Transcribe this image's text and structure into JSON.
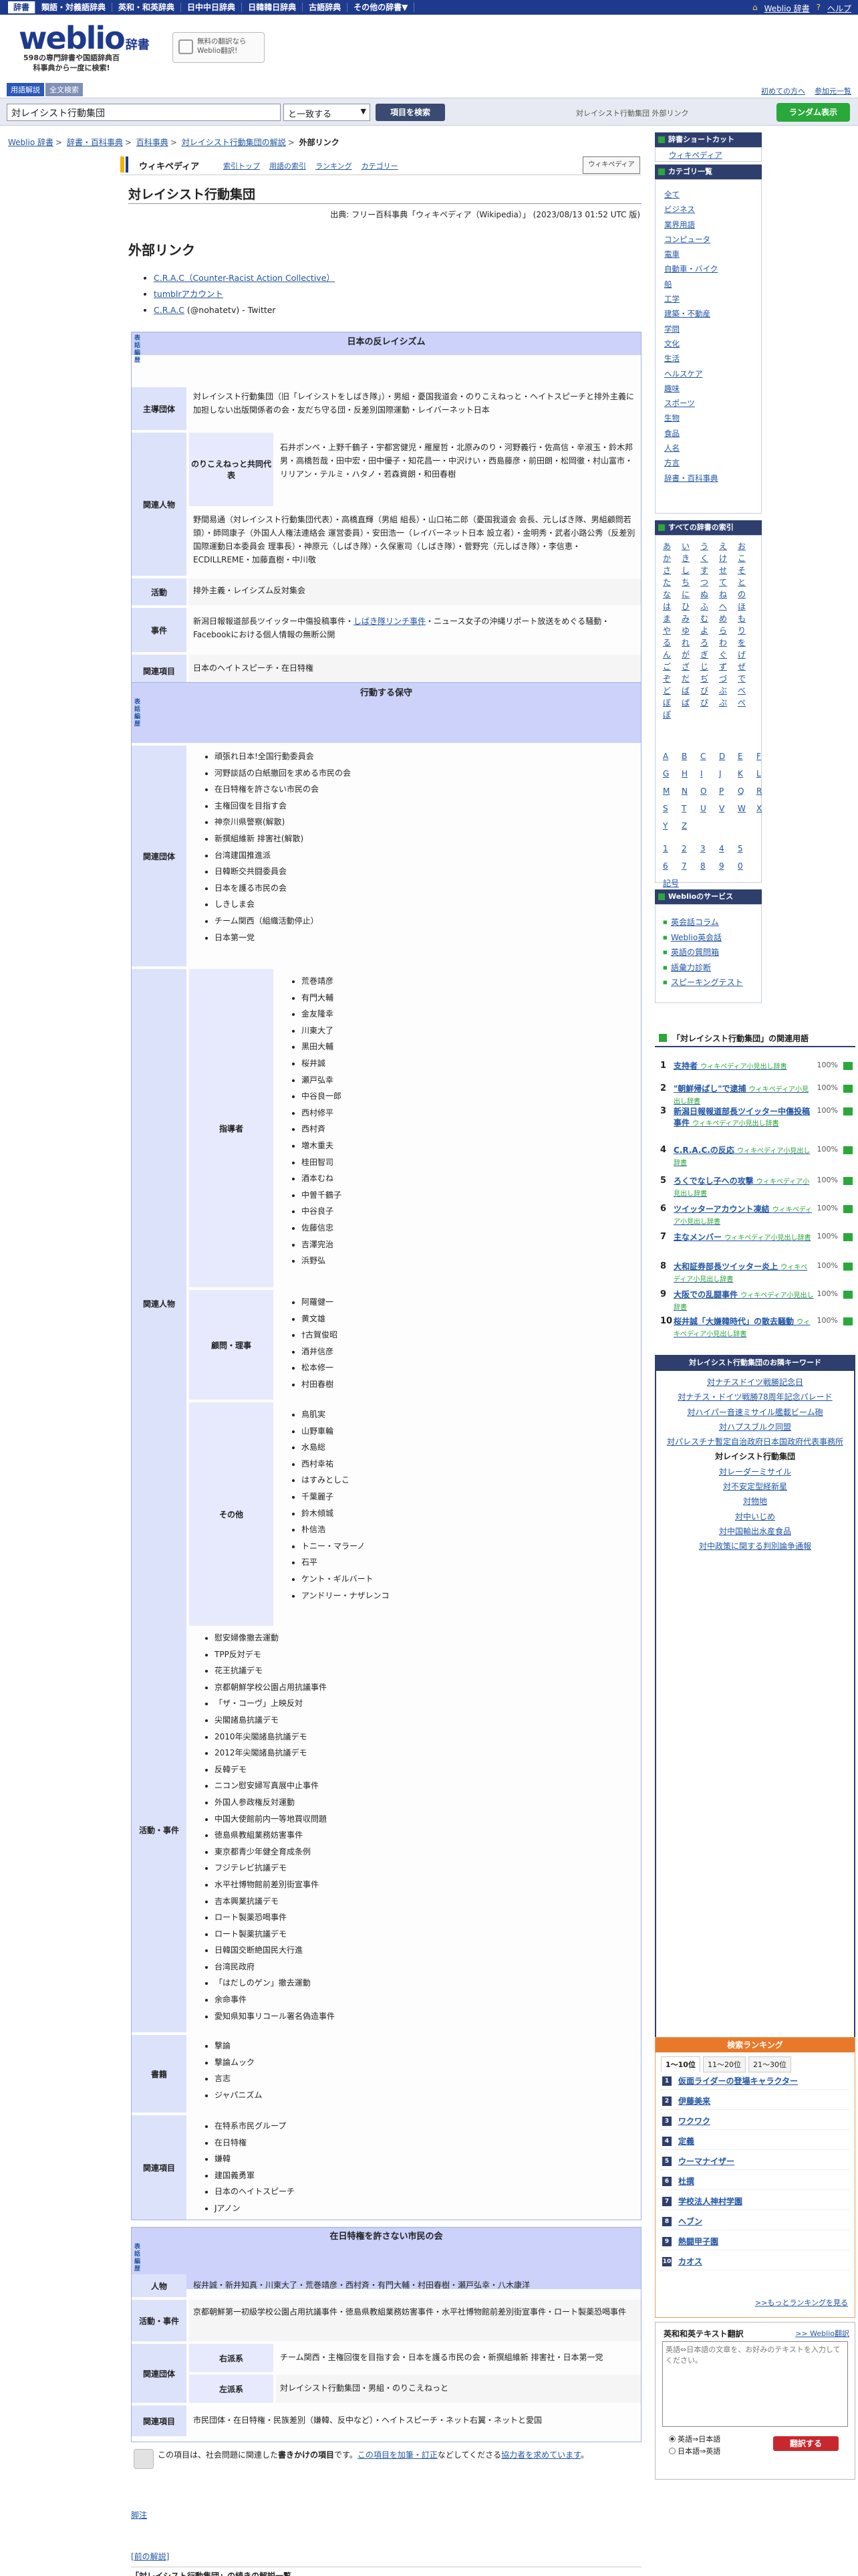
{
  "topnav": {
    "items": [
      "辞書",
      "類語・対義語辞典",
      "英和・和英辞典",
      "日中中日辞典",
      "日韓韓日辞典",
      "古語辞典",
      "その他の辞書▼"
    ],
    "links": [
      "Weblio 辞書",
      "ヘルプ"
    ]
  },
  "header": {
    "logo": "weblio",
    "logo_sub": "辞書",
    "tagline": "598の専門辞書や国語辞典百科事典から一度に検索!",
    "promo": "無料の翻訳なら Weblio翻訳!",
    "mode_tabs": [
      "用語解説",
      "全文検索"
    ],
    "util_links": [
      "初めての方へ",
      "参加元一覧"
    ]
  },
  "search": {
    "value": "対レイシスト行動集団",
    "match": "と一致する",
    "button": "項目を検索",
    "hint": "対レイシスト行動集団 外部リンク",
    "random": "ランダム表示"
  },
  "breadcrumb": [
    "Weblio 辞書",
    "辞書・百科事典",
    "百科事典",
    "対レイシスト行動集団の解説",
    "外部リンク"
  ],
  "wiki": {
    "name": "ウィキペディア",
    "tabs": [
      "索引トップ",
      "用語の索引",
      "ランキング",
      "カテゴリー"
    ],
    "logo": "ウィキペディア"
  },
  "article": {
    "title": "対レイシスト行動集団",
    "source": "出典: フリー百科事典「ウィキペディア（Wikipedia）」 (2023/08/13 01:52 UTC 版)",
    "section": "外部リンク",
    "links": [
      {
        "text": "C.R.A.C（Counter-Racist Action Collective）",
        "suffix": ""
      },
      {
        "text": "tumblrアカウント",
        "suffix": ""
      },
      {
        "text": "C.R.A.C",
        "suffix": " (@nohatetv) - Twitter"
      }
    ]
  },
  "vte": [
    "表",
    "話",
    "編",
    "歴"
  ],
  "nb1": {
    "title": "日本の反レイシズム",
    "org_label": "主導団体",
    "org": "対レイシスト行動集団（旧「レイシストをしばき隊」）・男組・憂国我道会・のりこえねっと・ヘイトスピーチと排外主義に加担しない出版関係者の会・友だち守る団・反差別国際運動・レイバーネット日本",
    "people_label": "関連人物",
    "sub_label": "のりこえねっと共同代表",
    "sub_people": "石井ポンペ・上野千鶴子・宇都宮健児・雁屋哲・北原みのり・河野義行・佐高信・辛淑玉・鈴木邦男・高橋哲哉・田中宏・田中優子・知花昌一・中沢けい・西島藤彦・前田朗・松岡徹・村山富市・リリアン・テルミ・ハタノ・若森資朗・和田春樹",
    "people": "野間易通（対レイシスト行動集団代表）・高橋直輝（男組 組長）・山口祐二郎（憂国我道会 会長、元しばき隊、男組顧問若頭）・師岡康子（外国人人権法連絡会 運営委員）・安田浩一（レイバーネット日本 設立者）・金明秀・武者小路公秀（反差別国際運動日本委員会 理事長）・神原元（しばき隊）・久保憲司（しばき隊）・菅野完（元しばき隊）・李信恵・ECDILLREME・加藤直樹・中川敬",
    "act_label": "活動",
    "act": "排外主義・レイシズム反対集会",
    "event_label": "事件",
    "event_pre": "新潟日報報道部長ツイッター中傷投稿事件・",
    "event_link": "しばき隊リンチ事件",
    "event_post": "・ニュース女子の沖縄リポート放送をめぐる騒動・Facebookにおける個人情報の無断公開",
    "rel_label": "関連項目",
    "rel": "日本のヘイトスピーチ・在日特権"
  },
  "nb2": {
    "title": "行動する保守",
    "org_label": "関連団体",
    "orgs": [
      "頑張れ日本!全国行動委員会",
      "河野談話の白紙撤回を求める市民の会",
      "在日特権を許さない市民の会",
      "主権回復を目指す会",
      "神奈川県警察(解散)",
      "新撰組維新 排害社(解散)",
      "台湾建国推進派",
      "日韓断交共闘委員会",
      "日本を護る市民の会",
      "しきしま会",
      "チーム関西（組織活動停止）",
      "日本第一党"
    ],
    "people_label": "関連人物",
    "leader_label": "指導者",
    "leaders": [
      "荒巻靖彦",
      "有門大輔",
      "金友隆幸",
      "川東大了",
      "黒田大輔",
      "桜井誠",
      "瀬戸弘幸",
      "中谷良一郎",
      "西村修平",
      "西村斉",
      "増木重夫",
      "桂田智司",
      "酒本むね",
      "中曽千鶴子",
      "中谷良子",
      "佐藤信忠",
      "吉澤完治",
      "浜野弘"
    ],
    "adviser_label": "顧問・理事",
    "advisers": [
      "阿羅健一",
      "黄文雄",
      "†古賀俊昭",
      "酒井信彦",
      "松本修一",
      "村田春樹"
    ],
    "other_label": "その他",
    "others": [
      "鳥肌実",
      "山野車輪",
      "水島総",
      "西村幸祐",
      "はすみとしこ",
      "千葉麗子",
      "鈴木傾城",
      "朴信浩",
      "トニー・マラーノ",
      "石平",
      "ケント・ギルバート",
      "アンドリー・ナザレンコ"
    ],
    "act_label": "活動・事件",
    "acts": [
      "慰安婦像撤去運動",
      "TPP反対デモ",
      "花王抗議デモ",
      "京都朝鮮学校公園占用抗議事件",
      "「ザ・コーヴ」上映反対",
      "尖閣諸島抗議デモ",
      "2010年尖閣諸島抗議デモ",
      "2012年尖閣諸島抗議デモ",
      "反韓デモ",
      "ニコン慰安婦写真展中止事件",
      "外国人参政権反対運動",
      "中国大使館前内一等地買収問題",
      "徳島県教組業務妨害事件",
      "東京都青少年健全育成条例",
      "フジテレビ抗議デモ",
      "水平社博物館前差別街宣事件",
      "吉本興業抗議デモ",
      "ロート製薬恐喝事件",
      "ロート製薬抗議デモ",
      "日韓国交断絶国民大行進",
      "台湾民政府",
      "「はだしのゲン」撤去運動",
      "余命事件",
      "愛知県知事リコール署名偽造事件"
    ],
    "book_label": "書籍",
    "books": [
      "撃論",
      "撃論ムック",
      "言志",
      "ジャパニズム"
    ],
    "rel_label": "関連項目",
    "rels": [
      "在特系市民グループ",
      "在日特権",
      "嫌韓",
      "建国義勇軍",
      "日本のヘイトスピーチ",
      "Jアノン"
    ]
  },
  "nb3": {
    "title": "在日特権を許さない市民の会",
    "person_label": "人物",
    "persons": "桜井誠・新井知真・川東大了・荒巻靖彦・西村斉・有門大輔・村田春樹・瀬戸弘幸・八木康洋",
    "act_label": "活動・事件",
    "acts": "京都朝鮮第一初級学校公園占用抗議事件・徳島県教組業務妨害事件・水平社博物館前差別街宣事件・ロート製薬恐喝事件",
    "org_label": "関連団体",
    "right_label": "右派系",
    "right": "チーム関西・主権回復を目指す会・日本を護る市民の会・新撰組維新 排害社・日本第一党",
    "left_label": "左派系",
    "left": "対レイシスト行動集団・男組・のりこえねっと",
    "rel_label": "関連項目",
    "rel": "市民団体・在日特権・民族差別（嫌韓、反中など）・ヘイトスピーチ・ネット右翼・ネットと愛国"
  },
  "stub": {
    "pre": "この項目は、社会問題に関連した",
    "bold": "書きかけの項目",
    "mid": "です。",
    "link1": "この項目を加筆・訂正",
    "mid2": "などしてくださる",
    "link2": "協力者を求めています",
    "end": "。"
  },
  "note_link": "脚注",
  "back_link": "[前の解説]",
  "bottom_title": "「対レイシスト行動集団」の続きの解説一覧",
  "sidebar": {
    "shortcut_head": "辞書ショートカット",
    "shortcut_item": "ウィキペディア",
    "cat_head": "カテゴリ一覧",
    "categories": [
      "全て",
      "ビジネス",
      "業界用語",
      "コンピュータ",
      "電車",
      "自動車・バイク",
      "船",
      "工学",
      "建築・不動産",
      "学問",
      "文化",
      "生活",
      "ヘルスケア",
      "趣味",
      "スポーツ",
      "生物",
      "食品",
      "人名",
      "方言",
      "辞書・百科事典"
    ],
    "kana_head": "すべての辞書の索引",
    "kana": [
      "あ",
      "い",
      "う",
      "え",
      "お",
      "か",
      "き",
      "く",
      "け",
      "こ",
      "さ",
      "し",
      "す",
      "せ",
      "そ",
      "た",
      "ち",
      "つ",
      "て",
      "と",
      "な",
      "に",
      "ぬ",
      "ね",
      "の",
      "は",
      "ひ",
      "ふ",
      "へ",
      "ほ",
      "ま",
      "み",
      "む",
      "め",
      "も",
      "や",
      "ゆ",
      "よ",
      "ら",
      "り",
      "る",
      "れ",
      "ろ",
      "わ",
      "を",
      "ん",
      "が",
      "ぎ",
      "ぐ",
      "げ",
      "ご",
      "ざ",
      "じ",
      "ず",
      "ぜ",
      "ぞ",
      "だ",
      "ぢ",
      "づ",
      "で",
      "ど",
      "ば",
      "び",
      "ぶ",
      "べ",
      "ぼ",
      "ぱ",
      "ぴ",
      "ぷ",
      "ぺ",
      "ぽ"
    ],
    "alpha": [
      "A",
      "B",
      "C",
      "D",
      "E",
      "F",
      "G",
      "H",
      "I",
      "J",
      "K",
      "L",
      "M",
      "N",
      "O",
      "P",
      "Q",
      "R",
      "S",
      "T",
      "U",
      "V",
      "W",
      "X",
      "Y",
      "Z"
    ],
    "digits": [
      "1",
      "2",
      "3",
      "4",
      "5",
      "6",
      "7",
      "8",
      "9",
      "0",
      "記号"
    ],
    "svc_head": "Weblioのサービス",
    "services": [
      "英会話コラム",
      "Weblio英会話",
      "英語の質問箱",
      "語彙力診断",
      "スピーキングテスト"
    ]
  },
  "related": {
    "head": "「対レイシスト行動集団」の関連用語",
    "items": [
      {
        "n": "1",
        "term": "支持者",
        "src": "ウィキペディア小見出し辞書",
        "pct": "100%"
      },
      {
        "n": "2",
        "term": "\"朝鮮帰ばし\"で逮捕",
        "src": "ウィキペディア小見出し辞書",
        "pct": "100%"
      },
      {
        "n": "3",
        "term": "新潟日報報道部長ツイッター中傷投稿事件",
        "src": "ウィキペディア小見出し辞書",
        "pct": "100%"
      },
      {
        "n": "4",
        "term": "C.R.A.C.の反応",
        "src": "ウィキペディア小見出し辞書",
        "pct": "100%"
      },
      {
        "n": "5",
        "term": "ろくでなし子への攻撃",
        "src": "ウィキペディア小見出し辞書",
        "pct": "100%"
      },
      {
        "n": "6",
        "term": "ツイッターアカウント凍結",
        "src": "ウィキペディア小見出し辞書",
        "pct": "100%"
      },
      {
        "n": "7",
        "term": "主なメンバー",
        "src": "ウィキペディア小見出し辞書",
        "pct": "100%"
      },
      {
        "n": "8",
        "term": "大和証券部長ツイッター炎上",
        "src": "ウィキペディア小見出し辞書",
        "pct": "100%"
      },
      {
        "n": "9",
        "term": "大阪での乱闘事件",
        "src": "ウィキペディア小見出し辞書",
        "pct": "100%"
      },
      {
        "n": "10",
        "term": "桜井誠「大嫌韓時代」の散去騒動",
        "src": "ウィキペディア小見出し辞書",
        "pct": "100%"
      }
    ]
  },
  "keywords": {
    "head": "対レイシスト行動集団のお隣キーワード",
    "items": [
      "対ナチスドイツ戦勝記念日",
      "対ナチス・ドイツ戦勝78周年記念パレード",
      "対ハイパー音速ミサイル艦載ビーム砲",
      "対ハプスブルク同盟",
      "対パレスチナ暫定自治政府日本国政府代表事務所",
      "対レイシスト行動集団",
      "対レーダーミサイル",
      "対不安定型経新星",
      "対物地",
      "対中いじめ",
      "対中国輸出水産食品",
      "対中政策に関する判別論争通報"
    ],
    "current": 5
  },
  "ranking": {
    "head": "検索ランキング",
    "tabs": [
      "1〜10位",
      "11〜20位",
      "21〜30位"
    ],
    "items": [
      "仮面ライダーの登場キャラクター",
      "伊藤美来",
      "ワクワク",
      "定義",
      "ウーマナイザー",
      "杜撰",
      "学校法人神村学園",
      "ヘブン",
      "熱闘甲子園",
      "カオス"
    ],
    "more": ">>もっとランキングを見る"
  },
  "translate": {
    "head": "英和和英テキスト翻訳",
    "link": ">> Weblio翻訳",
    "placeholder": "英語⇔日本語の文章を、お好みのテキストを入力してください。",
    "opt1": "英語⇒日本語",
    "opt2": "日本語⇒英語",
    "button": "翻訳する"
  }
}
